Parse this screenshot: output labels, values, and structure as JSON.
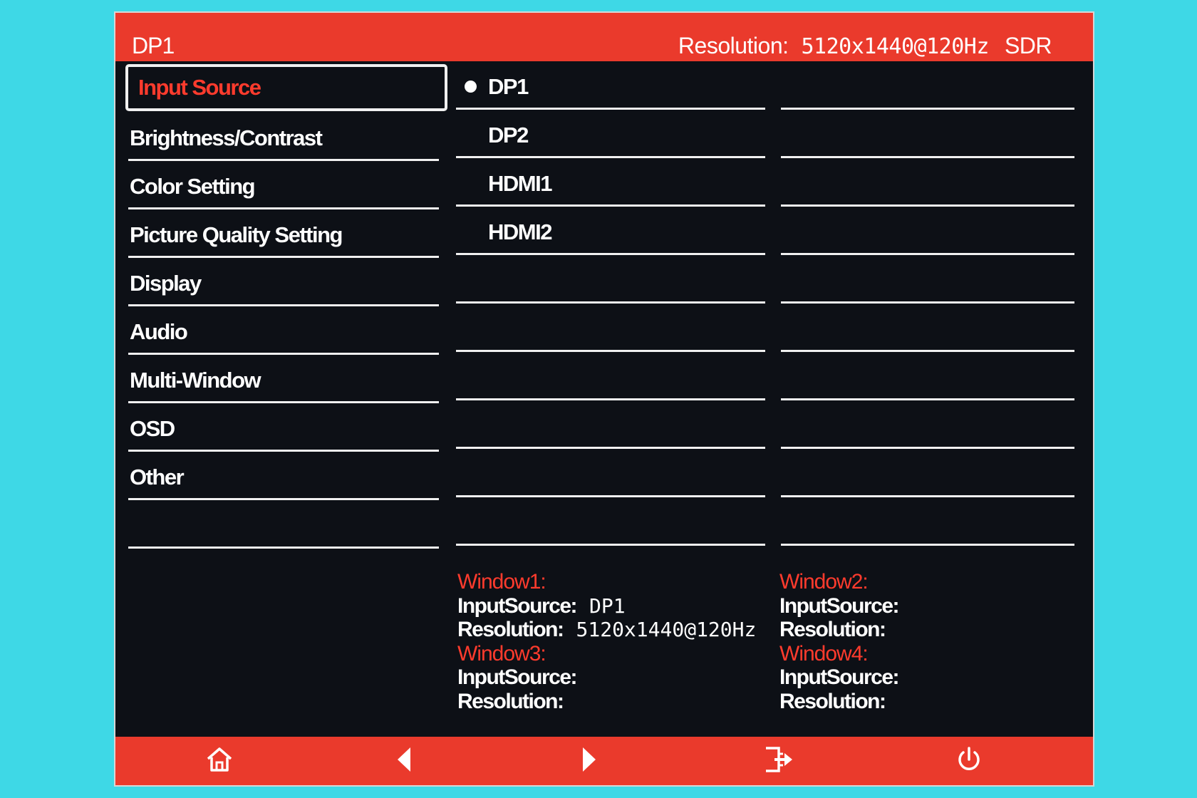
{
  "header": {
    "current_input": "DP1",
    "resolution_label": "Resolution:",
    "resolution_value": "5120x1440@120Hz",
    "dynamic_range": "SDR"
  },
  "menu": {
    "items": [
      {
        "label": "Input Source",
        "selected": true
      },
      {
        "label": "Brightness/Contrast"
      },
      {
        "label": "Color Setting"
      },
      {
        "label": "Picture Quality Setting"
      },
      {
        "label": "Display"
      },
      {
        "label": "Audio"
      },
      {
        "label": "Multi-Window"
      },
      {
        "label": "OSD"
      },
      {
        "label": "Other"
      },
      {
        "label": ""
      }
    ]
  },
  "input_options": [
    {
      "label": "DP1",
      "active": true
    },
    {
      "label": "DP2"
    },
    {
      "label": "HDMI1"
    },
    {
      "label": "HDMI2"
    }
  ],
  "windows": {
    "w1": {
      "title": "Window1:",
      "input_label": "InputSource:",
      "input_value": "DP1",
      "res_label": "Resolution:",
      "res_value": "5120x1440@120Hz"
    },
    "w2": {
      "title": "Window2:",
      "input_label": "InputSource:",
      "input_value": "",
      "res_label": "Resolution:",
      "res_value": ""
    },
    "w3": {
      "title": "Window3:",
      "input_label": "InputSource:",
      "input_value": "",
      "res_label": "Resolution:",
      "res_value": ""
    },
    "w4": {
      "title": "Window4:",
      "input_label": "InputSource:",
      "input_value": "",
      "res_label": "Resolution:",
      "res_value": ""
    }
  },
  "nav_buttons": [
    "home-icon",
    "left-arrow-icon",
    "right-arrow-icon",
    "exit-icon",
    "power-icon"
  ],
  "colors": {
    "accent": "#ea3a2c",
    "panel": "#0d1016",
    "highlight_text": "#ff3b2d",
    "background": "#3ed8e6"
  }
}
